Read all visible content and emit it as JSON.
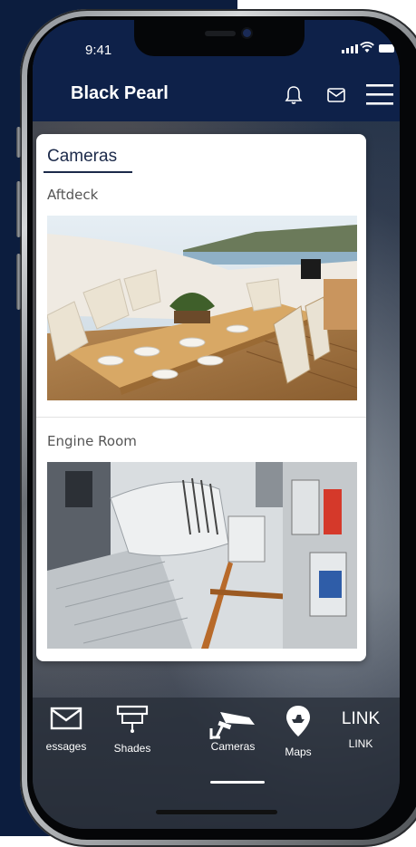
{
  "status": {
    "time": "9:41"
  },
  "header": {
    "title": "Black Pearl"
  },
  "cameras": {
    "title": "Cameras",
    "feeds": [
      {
        "label": "Aftdeck"
      },
      {
        "label": "Engine Room"
      }
    ]
  },
  "tabs": [
    {
      "label": "essages",
      "icon": "envelope-icon"
    },
    {
      "label": "Shades",
      "icon": "shade-icon"
    },
    {
      "label": "Cameras",
      "icon": "security-camera-icon",
      "active": true
    },
    {
      "label": "Maps",
      "icon": "map-pin-yacht-icon"
    },
    {
      "label": "LINK",
      "icon_text": "LINK"
    }
  ],
  "colors": {
    "navy": "#0e2149",
    "accent_text": "#1c2a4a",
    "card_bg": "#ffffff"
  }
}
